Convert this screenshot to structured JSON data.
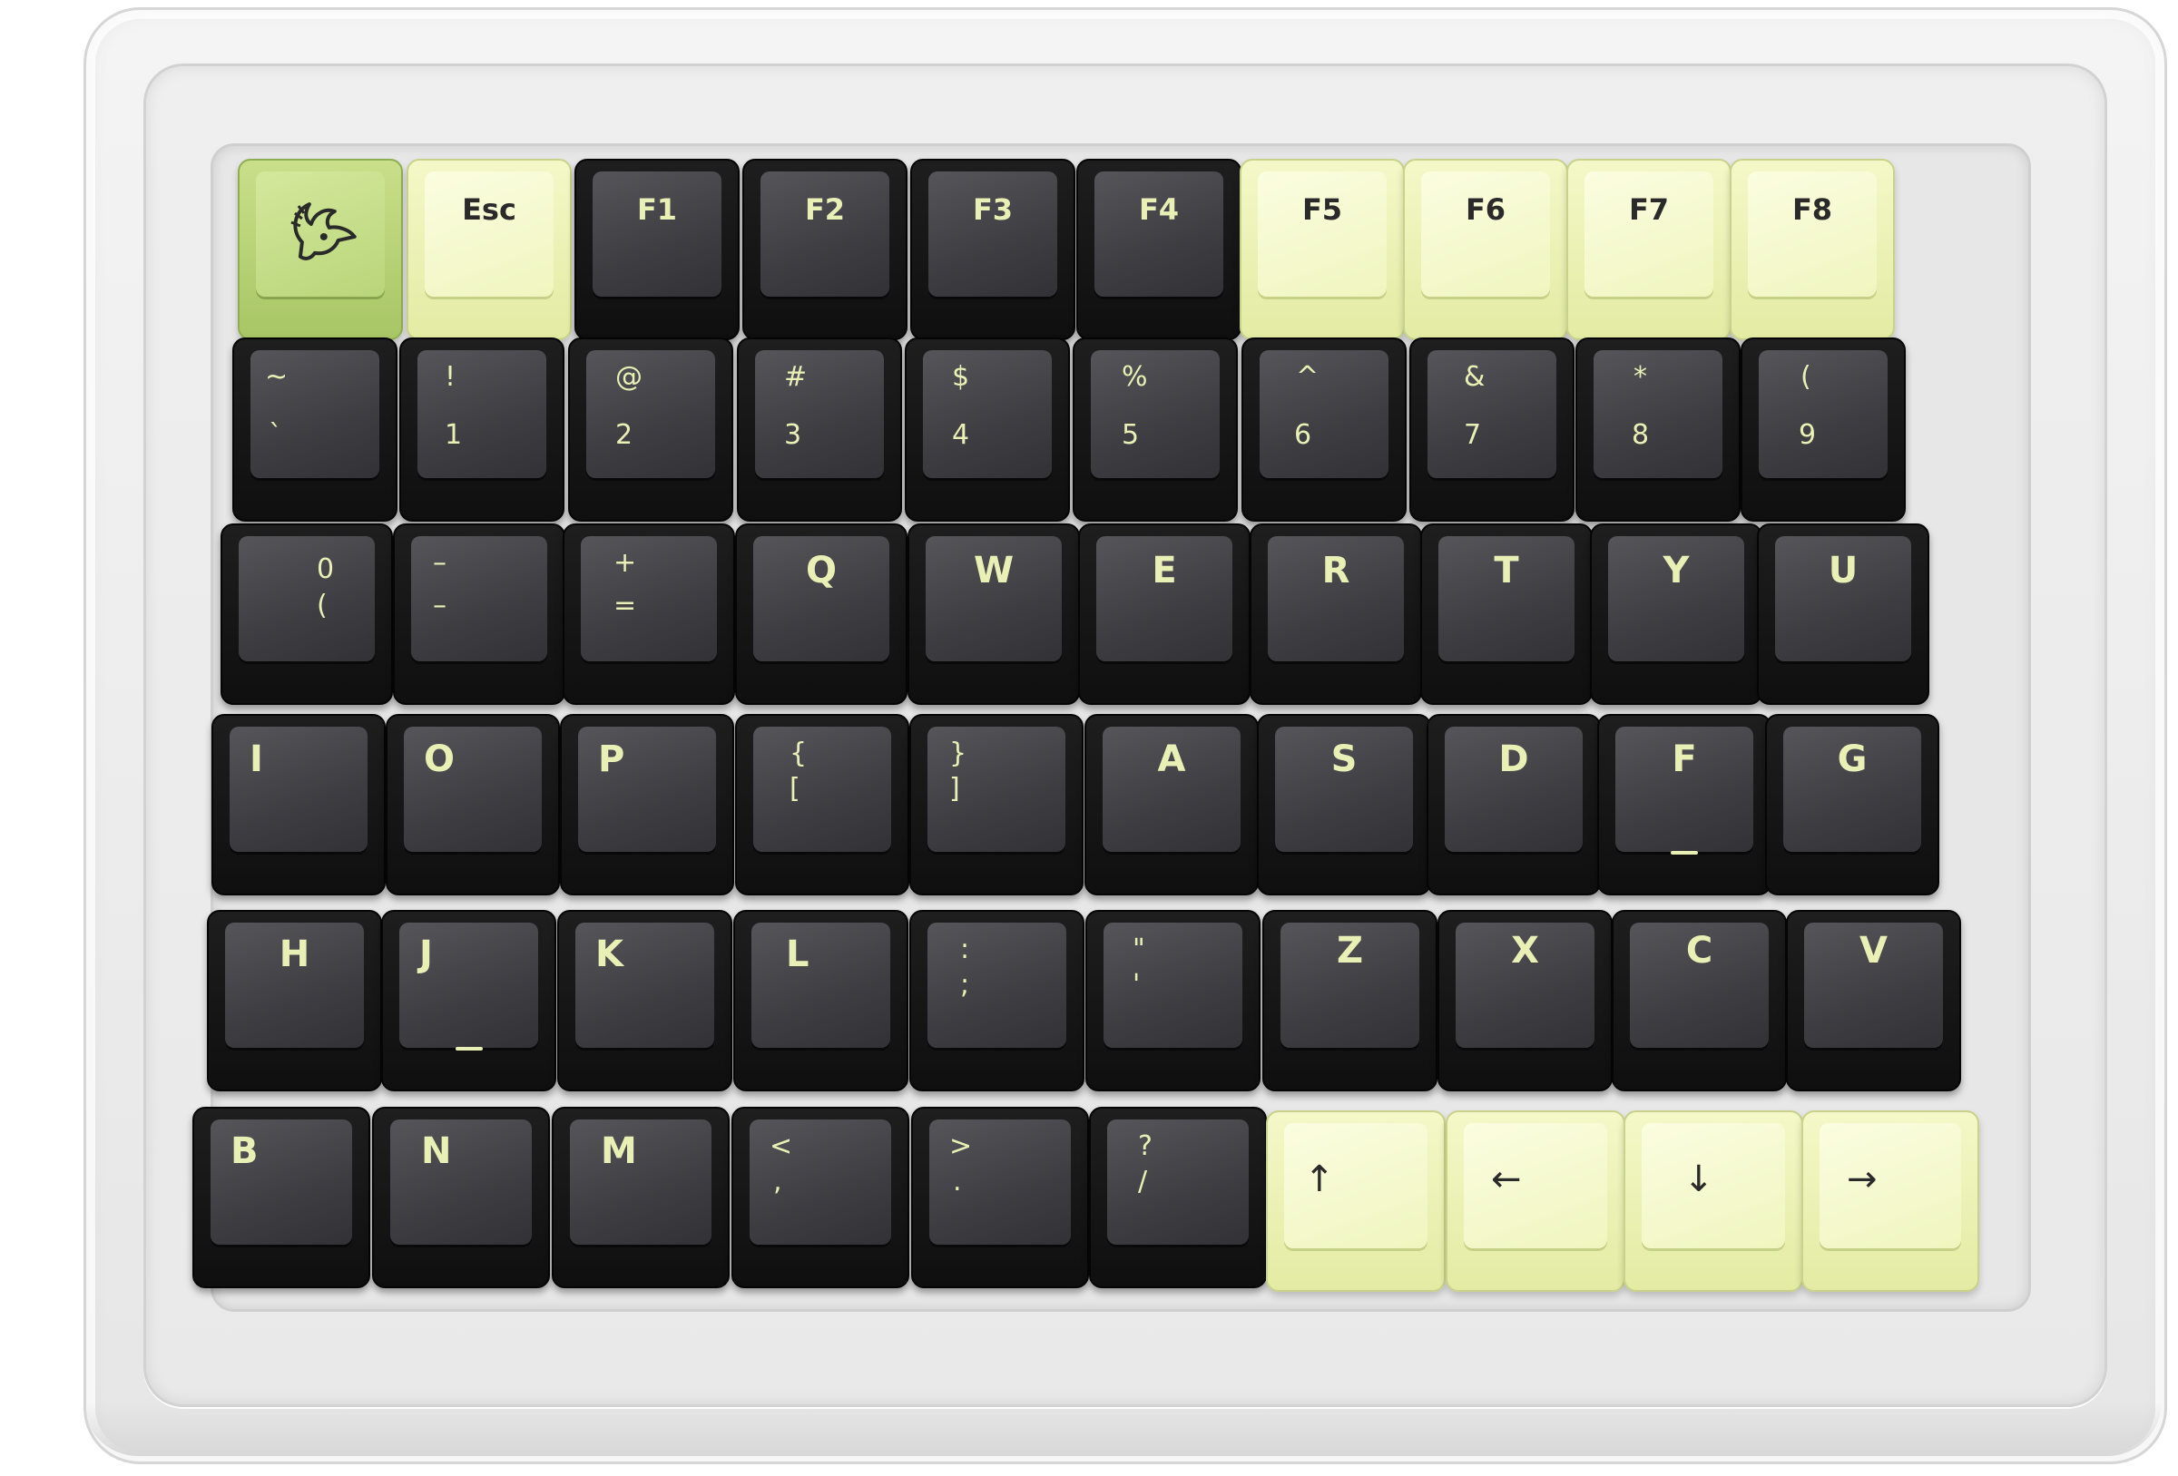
{
  "keycaps": {
    "row1": {
      "logo": "duck-logo",
      "esc": "Esc",
      "f1": "F1",
      "f2": "F2",
      "f3": "F3",
      "f4": "F4",
      "f5": "F5",
      "f6": "F6",
      "f7": "F7",
      "f8": "F8"
    },
    "row2": {
      "grave": {
        "upper": "~",
        "lower": "`"
      },
      "k1": {
        "upper": "!",
        "lower": "1"
      },
      "k2": {
        "upper": "@",
        "lower": "2"
      },
      "k3": {
        "upper": "#",
        "lower": "3"
      },
      "k4": {
        "upper": "$",
        "lower": "4"
      },
      "k5": {
        "upper": "%",
        "lower": "5"
      },
      "k6": {
        "upper": "^",
        "lower": "6"
      },
      "k7": {
        "upper": "&",
        "lower": "7"
      },
      "k8": {
        "upper": "*",
        "lower": "8"
      },
      "k9": {
        "upper": "(",
        "lower": "9"
      }
    },
    "row3": {
      "k0": {
        "upper": "0",
        "lower": "("
      },
      "minus": {
        "upper": "–",
        "lower": "–"
      },
      "equal": {
        "upper": "+",
        "lower": "="
      },
      "q": "Q",
      "w": "W",
      "e": "E",
      "r": "R",
      "t": "T",
      "y": "Y",
      "u": "U"
    },
    "row4": {
      "i": "I",
      "o": "O",
      "p": "P",
      "lbracket": {
        "upper": "{",
        "lower": "["
      },
      "rbracket": {
        "upper": "}",
        "lower": "]"
      },
      "a": "A",
      "s": "S",
      "d": "D",
      "f": "F",
      "g": "G"
    },
    "row5": {
      "h": "H",
      "j": "J",
      "k": "K",
      "l": "L",
      "semicolon": {
        "upper": ":",
        "lower": ";"
      },
      "quote": {
        "upper": "\"",
        "lower": "'"
      },
      "z": "Z",
      "x": "X",
      "c": "C",
      "v": "V"
    },
    "row6": {
      "b": "B",
      "n": "N",
      "m": "M",
      "comma": {
        "upper": "<",
        "lower": ","
      },
      "period": {
        "upper": ">",
        "lower": "."
      },
      "slash": {
        "upper": "?",
        "lower": "/"
      },
      "up": "↑",
      "left": "←",
      "down": "↓",
      "right": "→"
    }
  },
  "colors": {
    "dark_cap": "#111111",
    "dark_cap_top": "#45454a",
    "light_cap": "#eef3b8",
    "logo_cap": "#b9d57a",
    "legend_on_dark": "#e8f0b6",
    "legend_on_light": "#2a2a2a"
  }
}
